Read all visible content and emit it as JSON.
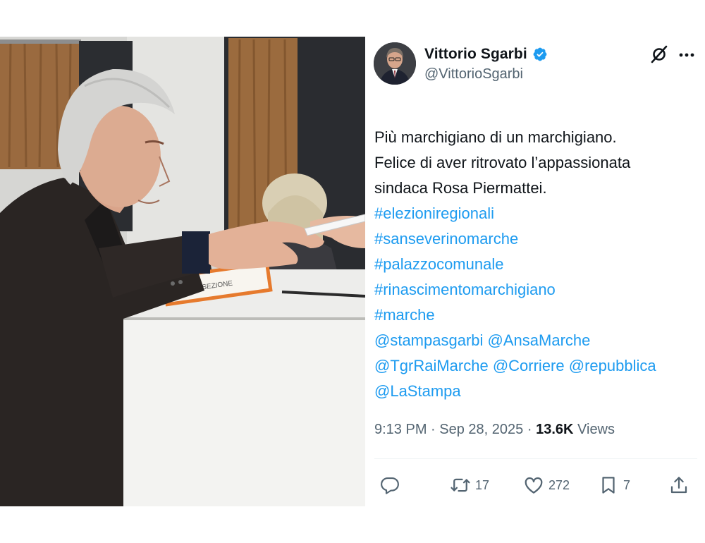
{
  "photo": {
    "ballot_box_label": "SEZIONE"
  },
  "tweet": {
    "author": {
      "display_name": "Vittorio Sgarbi",
      "handle": "@VittorioSgarbi",
      "verified": true
    },
    "text_lines": [
      "Più marchigiano di un marchigiano.",
      "Felice di aver ritrovato l’appassionata",
      "sindaca Rosa Piermattei."
    ],
    "hashtags": [
      "#elezioniregionali",
      "#sanseverinomarche",
      "#palazzocomunale",
      "#rinascimentomarchigiano",
      "#marche"
    ],
    "mentions_lines": [
      [
        "@stampasgarbi",
        "@AnsaMarche"
      ],
      [
        "@TgrRaiMarche",
        "@Corriere",
        "@repubblica"
      ],
      [
        "@LaStampa"
      ]
    ],
    "time": "9:13 PM",
    "separator": "·",
    "date": "Sep 28, 2025",
    "views_count": "13.6K",
    "views_label": "Views",
    "actions": {
      "reply_count": "",
      "retweet_count": "17",
      "like_count": "272",
      "bookmark_count": "7"
    },
    "colors": {
      "link": "#1d9bf0",
      "verified_badge": "#1d9bf0",
      "secondary_text": "#536471",
      "primary_text": "#0f1419"
    },
    "icons": [
      "grok-icon",
      "more-icon",
      "reply-icon",
      "retweet-icon",
      "like-icon",
      "bookmark-icon",
      "share-icon"
    ]
  }
}
